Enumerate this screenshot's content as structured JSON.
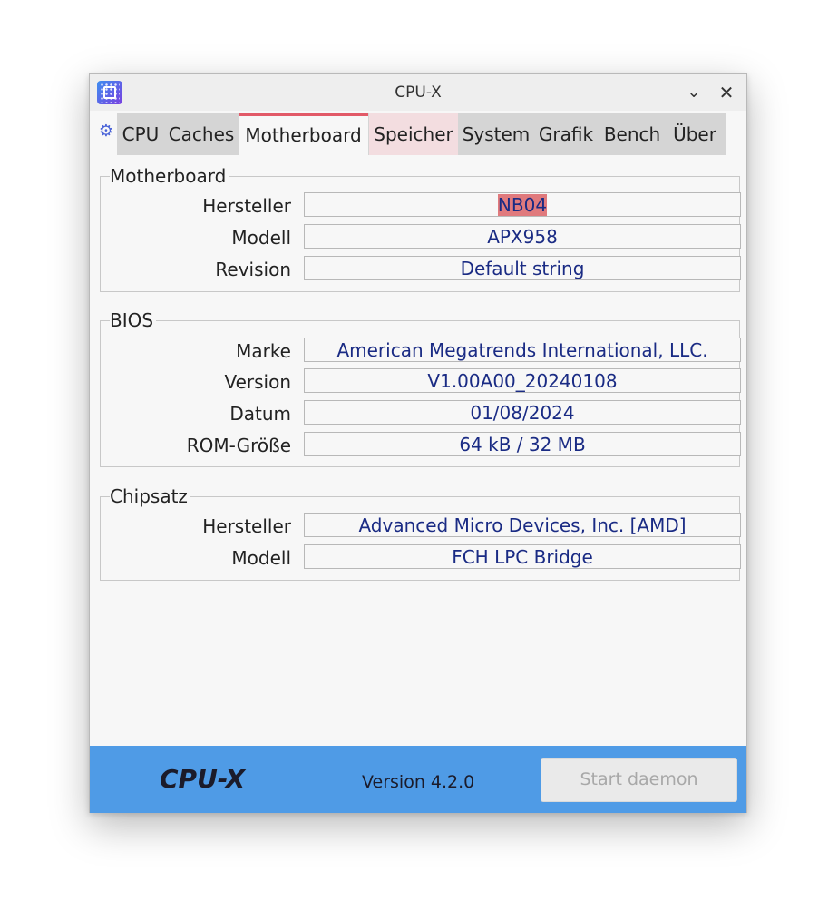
{
  "window": {
    "title": "CPU-X"
  },
  "tabs": [
    "CPU",
    "Caches",
    "Motherboard",
    "Speicher",
    "System",
    "Grafik",
    "Bench",
    "Über"
  ],
  "active_tab": "Motherboard",
  "motherboard": {
    "title": "Motherboard",
    "rows": [
      {
        "label": "Hersteller",
        "value": "NB04"
      },
      {
        "label": "Modell",
        "value": "APX958"
      },
      {
        "label": "Revision",
        "value": "Default string"
      }
    ]
  },
  "bios": {
    "title": "BIOS",
    "rows": [
      {
        "label": "Marke",
        "value": "American Megatrends International, LLC."
      },
      {
        "label": "Version",
        "value": "V1.00A00_20240108"
      },
      {
        "label": "Datum",
        "value": "01/08/2024"
      },
      {
        "label": "ROM-Größe",
        "value": "64 kB / 32 MB"
      }
    ]
  },
  "chipset": {
    "title": "Chipsatz",
    "rows": [
      {
        "label": "Hersteller",
        "value": "Advanced Micro Devices, Inc. [AMD]"
      },
      {
        "label": "Modell",
        "value": "FCH LPC Bridge"
      }
    ]
  },
  "footer": {
    "brand": "CPU-X",
    "version": "Version 4.2.0",
    "daemon_button": "Start daemon"
  },
  "icons": {
    "app": "cpu-chip-icon",
    "settings": "gears-icon",
    "minimize": "chevron-down-icon",
    "close": "close-icon"
  },
  "colors": {
    "accent_tab": "#e25a68",
    "value_text": "#1a2b84",
    "footer_bg": "#4f9be6",
    "highlight": "#e07a7d"
  }
}
